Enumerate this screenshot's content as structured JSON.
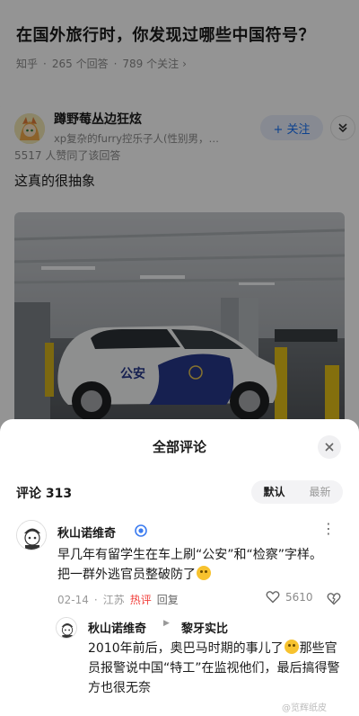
{
  "question": {
    "title": "在国外旅行时，你发现过哪些中国符号？",
    "source": "知乎",
    "answers": "265 个回答",
    "followers": "789 个关注",
    "chevron": "›"
  },
  "answer": {
    "author_name": "蹲野莓丛边狂炫",
    "author_bio": "xp复杂的furry控乐子人(性别男，…",
    "follow_label": "+ 关注",
    "agree_line": "5517 人赞同了该回答",
    "text": "这真的很抽象",
    "photo_car_text": "公安"
  },
  "sheet": {
    "title": "全部评论",
    "comment_count": "评论 313",
    "sort_default": "默认",
    "sort_latest": "最新"
  },
  "comments": [
    {
      "name": "秋山诺维奇",
      "text_a": "早几年有留学生在车上刷“公安”和“检察”字样。",
      "text_b": "把一群外逃官员整破防了",
      "date": "02-14",
      "region": "江苏",
      "hot": "热评",
      "reply": "回复",
      "likes": "5610"
    },
    {
      "name": "秋山诺维奇",
      "reply_to": "黎牙实比",
      "text_a": "2010年前后，奥巴马时期的事儿了",
      "text_b": "那些官",
      "text_c": "员报警说中国“特工”在监视他们，最后搞得警",
      "text_d": "方也很无奈"
    }
  ],
  "watermark": "@览辉纸皮",
  "colors": {
    "accent": "#1772f6",
    "hot": "#f1403c",
    "verified": "#3c7cf0"
  }
}
